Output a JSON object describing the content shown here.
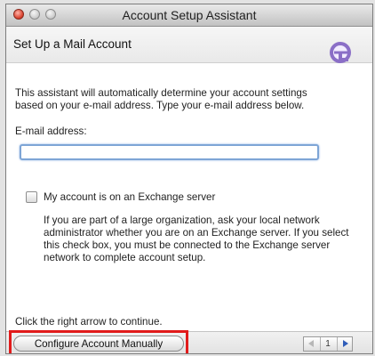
{
  "window": {
    "title": "Account Setup Assistant"
  },
  "header": {
    "heading": "Set Up a Mail Account",
    "logo_icon": "entourage-logo-icon"
  },
  "content": {
    "intro": "This assistant will automatically determine your account settings\nbased on your e-mail address. Type your e-mail address below.",
    "email_label": "E-mail address:",
    "email_value": "",
    "exchange_checkbox_label": "My account is on an Exchange server",
    "exchange_checked": false,
    "exchange_note": "If you are part of a large organization, ask your local network\nadministrator whether you are on an Exchange server. If you select\nthis check box, you must be connected to the Exchange server\nnetwork to complete account setup.",
    "continue_text": "Click the right arrow to continue."
  },
  "footer": {
    "configure_button": "Configure Account Manually",
    "page_number": "1",
    "prev_icon": "left-arrow-icon",
    "next_icon": "right-arrow-icon"
  },
  "colors": {
    "highlight": "#e11b1b",
    "logo": "#8b6fc7",
    "next_arrow": "#2f5db9"
  }
}
